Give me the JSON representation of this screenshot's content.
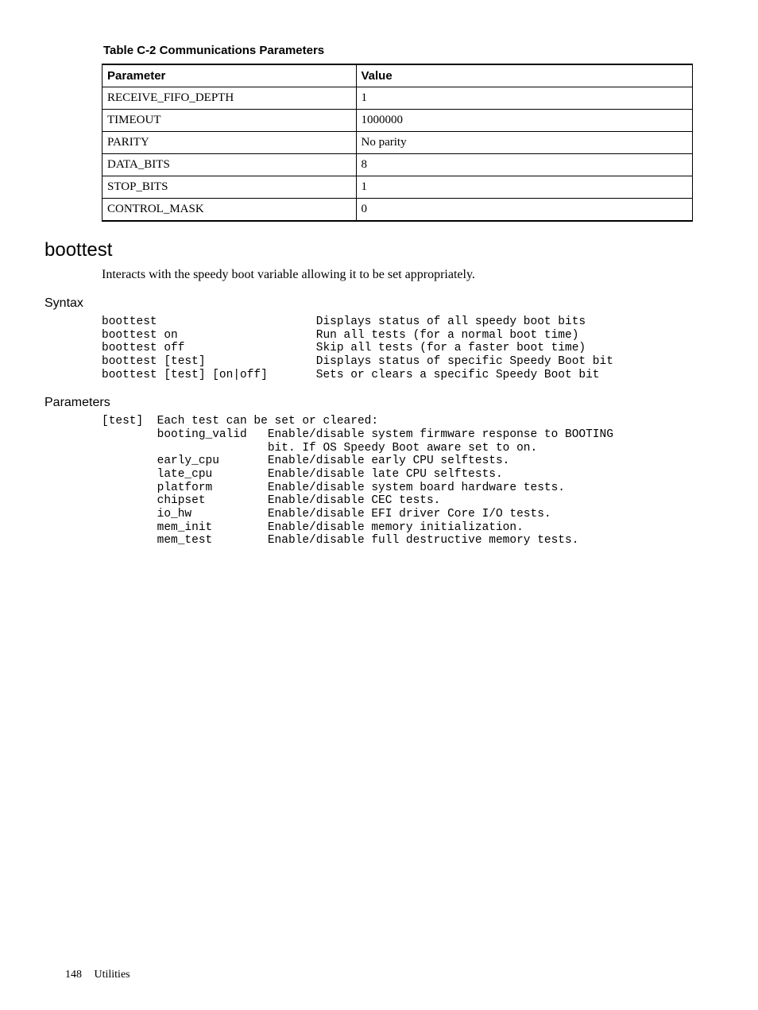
{
  "table": {
    "title": "Table C-2 Communications Parameters",
    "headers": {
      "param": "Parameter",
      "value": "Value"
    },
    "rows": [
      {
        "param": "RECEIVE_FIFO_DEPTH",
        "value": "1"
      },
      {
        "param": "TIMEOUT",
        "value": "1000000"
      },
      {
        "param": "PARITY",
        "value": "No parity"
      },
      {
        "param": "DATA_BITS",
        "value": "8"
      },
      {
        "param": "STOP_BITS",
        "value": "1"
      },
      {
        "param": "CONTROL_MASK",
        "value": "0"
      }
    ]
  },
  "sections": {
    "boottest": {
      "heading": "boottest",
      "body": "Interacts with the speedy boot variable allowing it to be set appropriately."
    },
    "syntax": {
      "heading": "Syntax",
      "pre": "boottest                       Displays status of all speedy boot bits\nboottest on                    Run all tests (for a normal boot time)\nboottest off                   Skip all tests (for a faster boot time)\nboottest [test]                Displays status of specific Speedy Boot bit\nboottest [test] [on|off]       Sets or clears a specific Speedy Boot bit"
    },
    "parameters": {
      "heading": "Parameters",
      "pre": "[test]  Each test can be set or cleared:\n        booting_valid   Enable/disable system firmware response to BOOTING \n                        bit. If OS Speedy Boot aware set to on.\n        early_cpu       Enable/disable early CPU selftests.\n        late_cpu        Enable/disable late CPU selftests.\n        platform        Enable/disable system board hardware tests.\n        chipset         Enable/disable CEC tests.\n        io_hw           Enable/disable EFI driver Core I/O tests.\n        mem_init        Enable/disable memory initialization.\n        mem_test        Enable/disable full destructive memory tests."
    }
  },
  "footer": {
    "page": "148",
    "section": "Utilities"
  }
}
